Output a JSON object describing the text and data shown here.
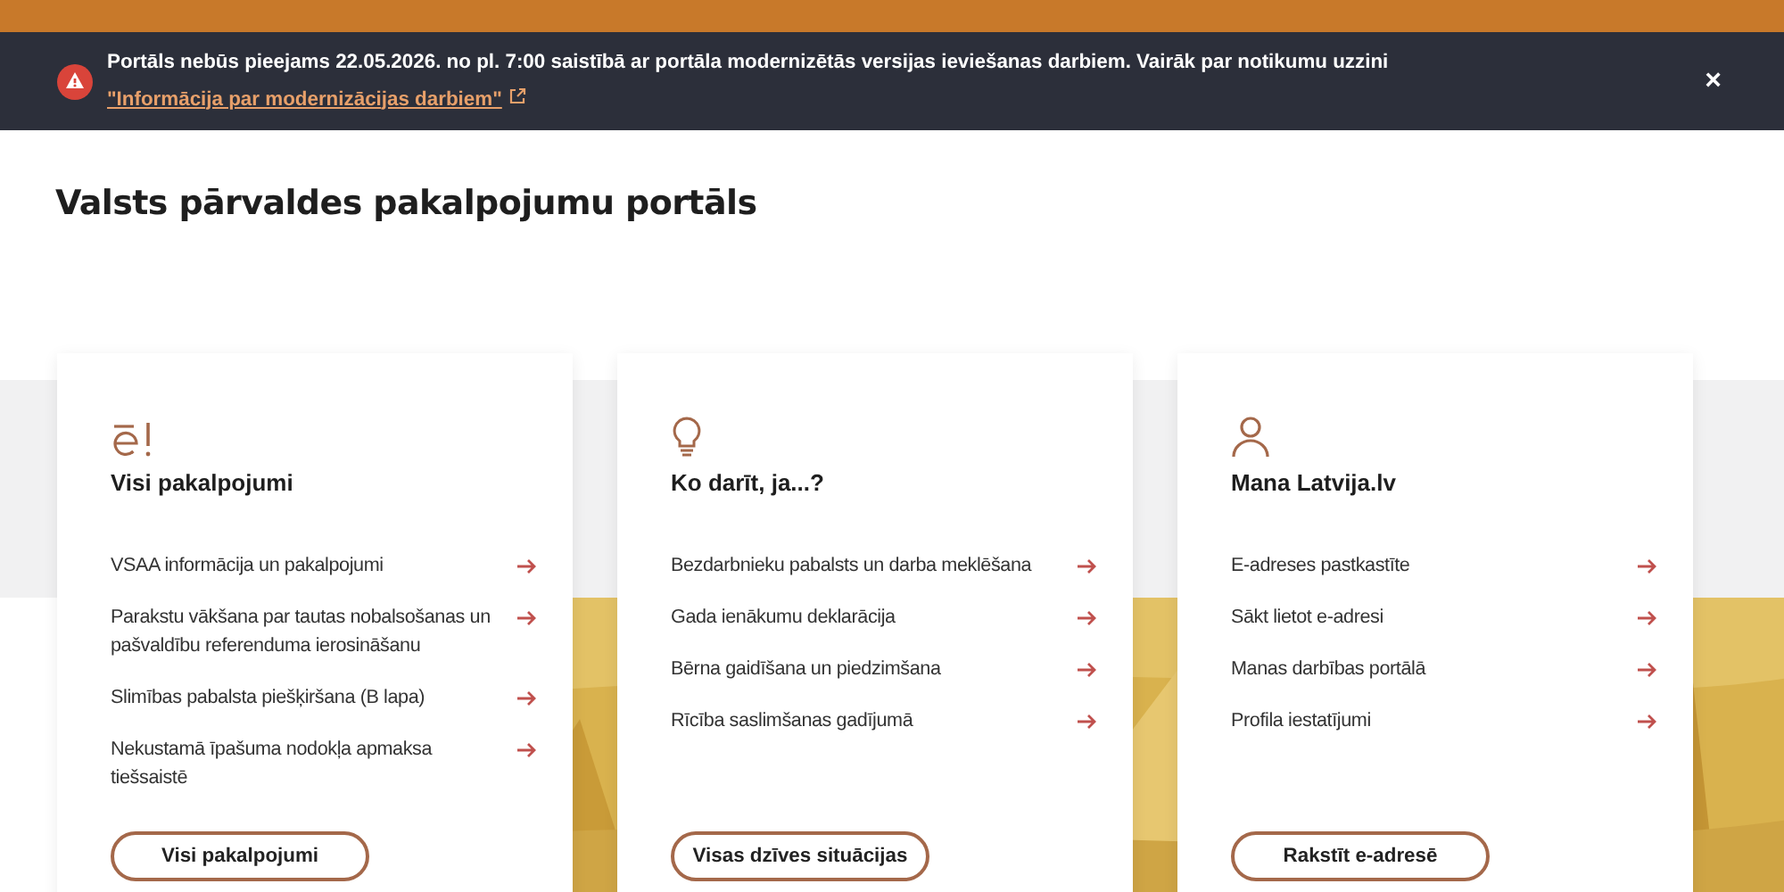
{
  "alert": {
    "message": "Portāls nebūs pieejams 22.05.2026. no pl. 7:00 saistībā ar portāla modernizētās versijas ieviešanas darbiem. Vairāk par notikumu uzzini ",
    "link": "\"Informācija par modernizācijas darbiem\"",
    "close": "×"
  },
  "page_title": "Valsts pārvaldes pakalpojumu portāls",
  "cards": [
    {
      "kind": "services",
      "title": "Visi pakalpojumi",
      "items": [
        "VSAA informācija un pakalpojumi",
        "Parakstu vākšana par tautas nobalsošanas un pašvaldību referenduma ierosināšanu",
        "Slimības pabalsta piešķiršana (B lapa)",
        "Nekustamā īpašuma nodokļa apmaksa tiešsaistē"
      ],
      "button": "Visi pakalpojumi"
    },
    {
      "kind": "ideas",
      "title": "Ko darīt, ja...?",
      "items": [
        "Bezdarbnieku pabalsts un darba meklēšana",
        "Gada ienākumu deklarācija",
        "Bērna gaidīšana un piedzimšana",
        "Rīcība saslimšanas gadījumā"
      ],
      "button": "Visas dzīves situācijas"
    },
    {
      "kind": "profile",
      "title": "Mana Latvija.lv",
      "items": [
        "E-adreses pastkastīte",
        "Sākt lietot e-adresi",
        "Manas darbības portālā",
        "Profila iestatījumi"
      ],
      "button": "Rakstīt e-adresē"
    }
  ]
}
